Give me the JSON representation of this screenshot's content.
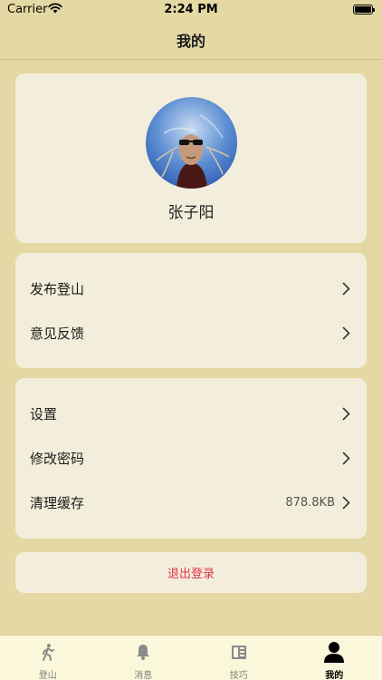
{
  "status_bar": {
    "carrier": "Carrier",
    "time": "2:24 PM"
  },
  "nav": {
    "title": "我的"
  },
  "profile": {
    "name": "张子阳",
    "avatar_icon": "user-avatar-photo"
  },
  "menu_group_1": [
    {
      "label": "发布登山"
    },
    {
      "label": "意见反馈"
    }
  ],
  "menu_group_2": [
    {
      "label": "设置",
      "value": ""
    },
    {
      "label": "修改密码",
      "value": ""
    },
    {
      "label": "清理缓存",
      "value": "878.8KB"
    }
  ],
  "logout": {
    "label": "退出登录"
  },
  "tabs": [
    {
      "label": "登山",
      "icon": "hiker-icon"
    },
    {
      "label": "消息",
      "icon": "bell-icon"
    },
    {
      "label": "技巧",
      "icon": "book-icon"
    },
    {
      "label": "我的",
      "icon": "person-icon"
    }
  ],
  "colors": {
    "background": "#e4d8a4",
    "card": "#f3eedb",
    "tab_bar": "#fbf7da",
    "logout_text": "#e0344c"
  }
}
